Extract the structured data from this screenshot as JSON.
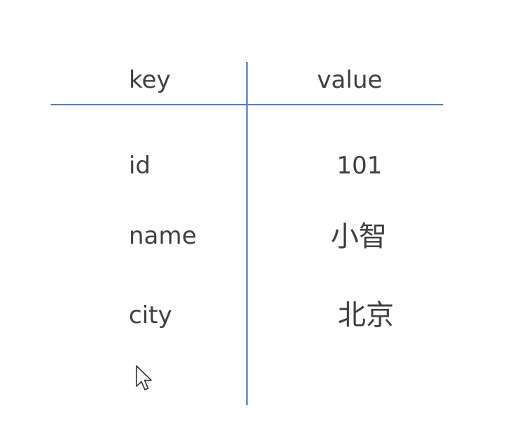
{
  "table": {
    "headers": {
      "key": "key",
      "value": "value"
    },
    "rows": [
      {
        "key": "id",
        "value": "101"
      },
      {
        "key": "name",
        "value": "小智"
      },
      {
        "key": "city",
        "value": "北京"
      }
    ]
  },
  "colors": {
    "line": "#4f7fc2",
    "text": "#404040",
    "background": "#ffffff"
  },
  "icons": {
    "cursor": "mouse-pointer-icon"
  }
}
